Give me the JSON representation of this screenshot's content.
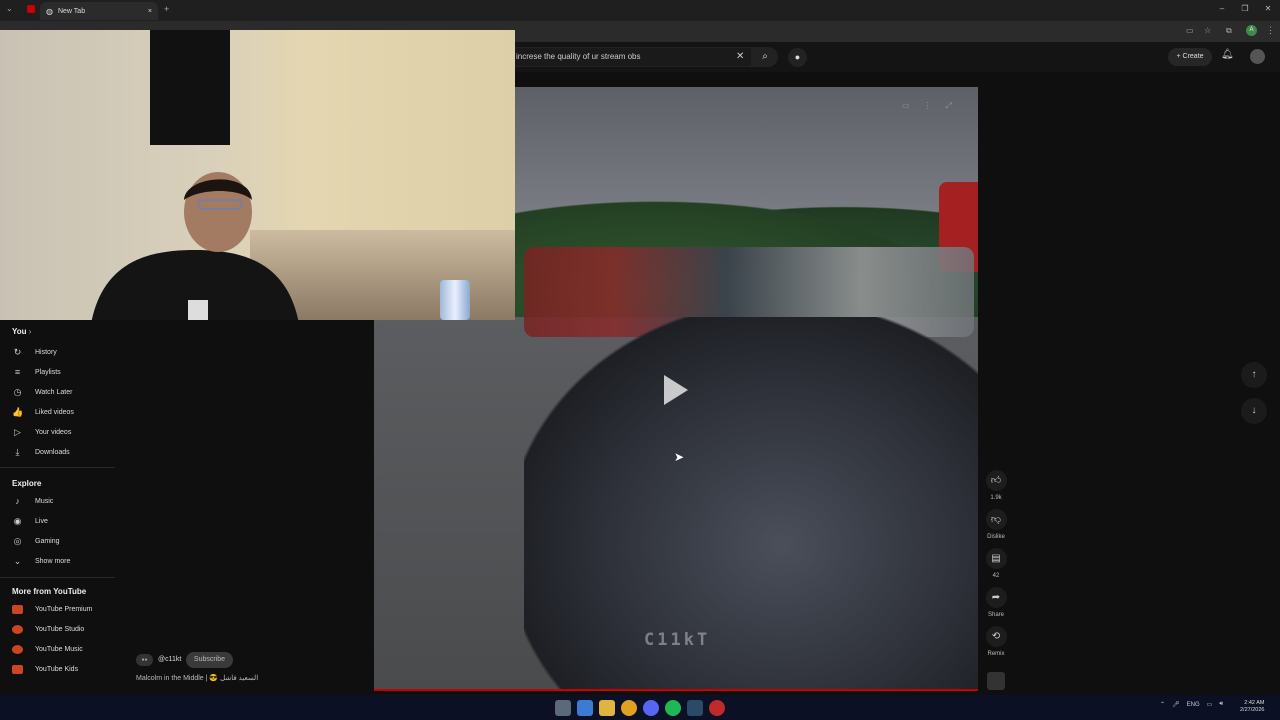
{
  "browser": {
    "tab_title": "New Tab",
    "new_tab": "+",
    "close_tab": "×"
  },
  "youtube": {
    "search_value": "increse the quality of ur stream obs",
    "create_label": "Create"
  },
  "sidebar": {
    "you_label": "You",
    "you_items": [
      {
        "icon": "history-icon",
        "glyph": "↻",
        "label": "History"
      },
      {
        "icon": "playlists-icon",
        "glyph": "≡",
        "label": "Playlists"
      },
      {
        "icon": "watch-later-icon",
        "glyph": "◷",
        "label": "Watch Later"
      },
      {
        "icon": "thumbs-up-icon",
        "glyph": "👍",
        "label": "Liked videos"
      },
      {
        "icon": "your-videos-icon",
        "glyph": "▷",
        "label": "Your videos"
      },
      {
        "icon": "download-icon",
        "glyph": "⤓",
        "label": "Downloads"
      }
    ],
    "explore_label": "Explore",
    "explore_items": [
      {
        "icon": "music-icon",
        "glyph": "♪",
        "label": "Music"
      },
      {
        "icon": "live-icon",
        "glyph": "◉",
        "label": "Live"
      },
      {
        "icon": "gaming-icon",
        "glyph": "◎",
        "label": "Gaming"
      },
      {
        "icon": "chevron-down-icon",
        "glyph": "⌄",
        "label": "Show more"
      }
    ],
    "more_label": "More from YouTube",
    "more_items": [
      {
        "label": "YouTube Premium"
      },
      {
        "label": "YouTube Studio"
      },
      {
        "label": "YouTube Music"
      },
      {
        "label": "YouTube Kids"
      }
    ]
  },
  "video": {
    "watermark": "C11kT",
    "channel": "@c11kt",
    "subscribe": "Subscribe",
    "title": "Malcolm in the Middle | 😎 السعيد فاشل"
  },
  "actions": {
    "like_count": "1.9k",
    "dislike": "Dislike",
    "comments": "42",
    "share": "Share",
    "remix": "Remix"
  },
  "taskbar": {
    "lang": "ENG",
    "time": "2:42 AM",
    "date": "2/27/2026"
  },
  "colors": {
    "progress": "#cc0000",
    "taskbar": "#0c1024"
  }
}
